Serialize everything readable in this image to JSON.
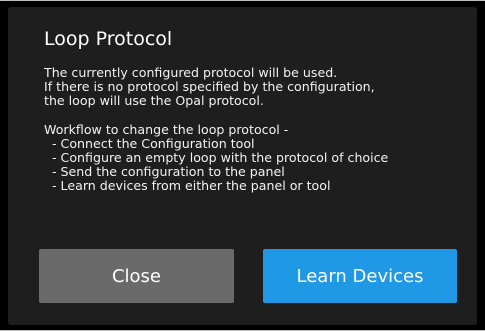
{
  "dialog": {
    "title": "Loop Protocol",
    "paragraph1": [
      "The currently configured protocol will be used.",
      "If there is no protocol specified by the configuration,",
      "the loop will use the Opal protocol."
    ],
    "paragraph2": [
      "Workflow to change the loop protocol -",
      "  - Connect the Configuration tool",
      "  - Configure an empty loop with the protocol of choice",
      "  - Send the configuration to the panel",
      "  - Learn devices from either the panel or tool"
    ],
    "close_label": "Close",
    "learn_label": "Learn Devices"
  },
  "colors": {
    "background": "#000000",
    "dialog": "#1e1e1e",
    "close_button": "#6a6a6a",
    "learn_button": "#1f98e6",
    "text": "#ffffff"
  }
}
